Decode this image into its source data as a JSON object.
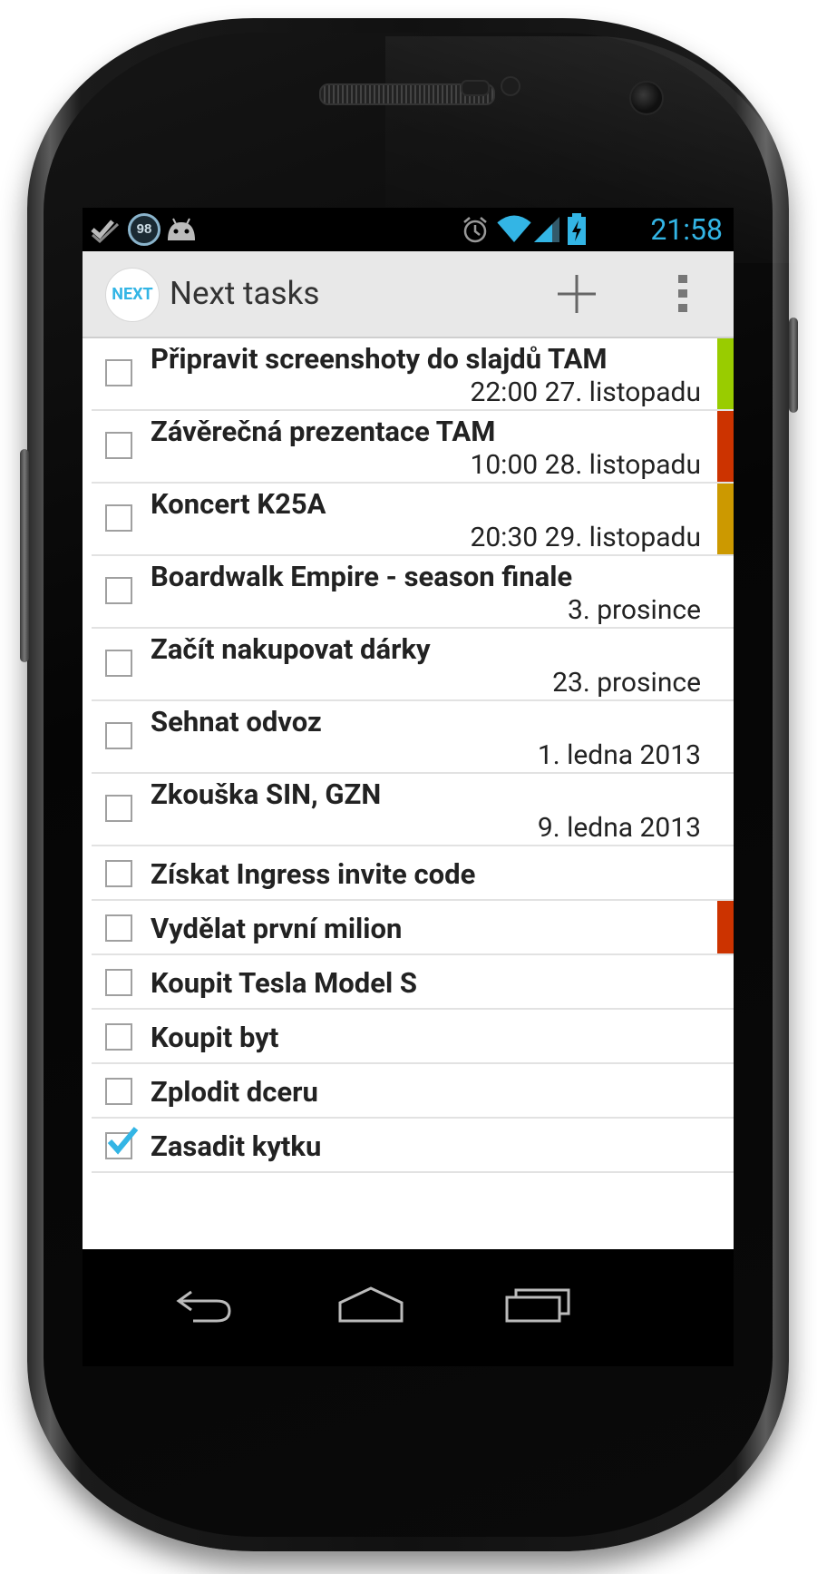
{
  "status_bar": {
    "time": "21:58",
    "left_icons": [
      "foursquare-icon",
      "notification-count-badge",
      "android-icon"
    ],
    "notification_count": "98",
    "right_icons": [
      "alarm-icon",
      "wifi-icon",
      "signal-icon",
      "battery-charging-icon"
    ]
  },
  "action_bar": {
    "logo_text": "NEXT",
    "title": "Next tasks",
    "actions": [
      "add-icon",
      "overflow-menu-icon"
    ]
  },
  "tasks": [
    {
      "name": "Připravit screenshoty do slajdů TAM",
      "date": "22:00 27. listopadu",
      "checked": false,
      "priority_color": "#99cc00"
    },
    {
      "name": "Závěrečná prezentace TAM",
      "date": "10:00 28. listopadu",
      "checked": false,
      "priority_color": "#cc3300"
    },
    {
      "name": "Koncert K25A",
      "date": "20:30 29. listopadu",
      "checked": false,
      "priority_color": "#cc9900"
    },
    {
      "name": "Boardwalk Empire - season finale",
      "date": "3. prosince",
      "checked": false,
      "priority_color": ""
    },
    {
      "name": "Začít nakupovat dárky",
      "date": "23. prosince",
      "checked": false,
      "priority_color": ""
    },
    {
      "name": "Sehnat odvoz",
      "date": "1. ledna 2013",
      "checked": false,
      "priority_color": ""
    },
    {
      "name": "Zkouška SIN, GZN",
      "date": "9. ledna 2013",
      "checked": false,
      "priority_color": ""
    },
    {
      "name": "Získat Ingress invite code",
      "date": "",
      "checked": false,
      "priority_color": ""
    },
    {
      "name": "Vydělat první milion",
      "date": "",
      "checked": false,
      "priority_color": "#cc3300"
    },
    {
      "name": "Koupit Tesla Model S",
      "date": "",
      "checked": false,
      "priority_color": ""
    },
    {
      "name": "Koupit byt",
      "date": "",
      "checked": false,
      "priority_color": ""
    },
    {
      "name": "Zplodit dceru",
      "date": "",
      "checked": false,
      "priority_color": ""
    },
    {
      "name": "Zasadit kytku",
      "date": "",
      "checked": true,
      "priority_color": ""
    }
  ],
  "nav_bar": [
    "back-icon",
    "home-icon",
    "recent-apps-icon"
  ],
  "colors": {
    "accent": "#33b5e5",
    "action_bar_bg": "#e8e8e8",
    "priority_green": "#99cc00",
    "priority_red": "#cc3300",
    "priority_orange": "#cc9900"
  }
}
